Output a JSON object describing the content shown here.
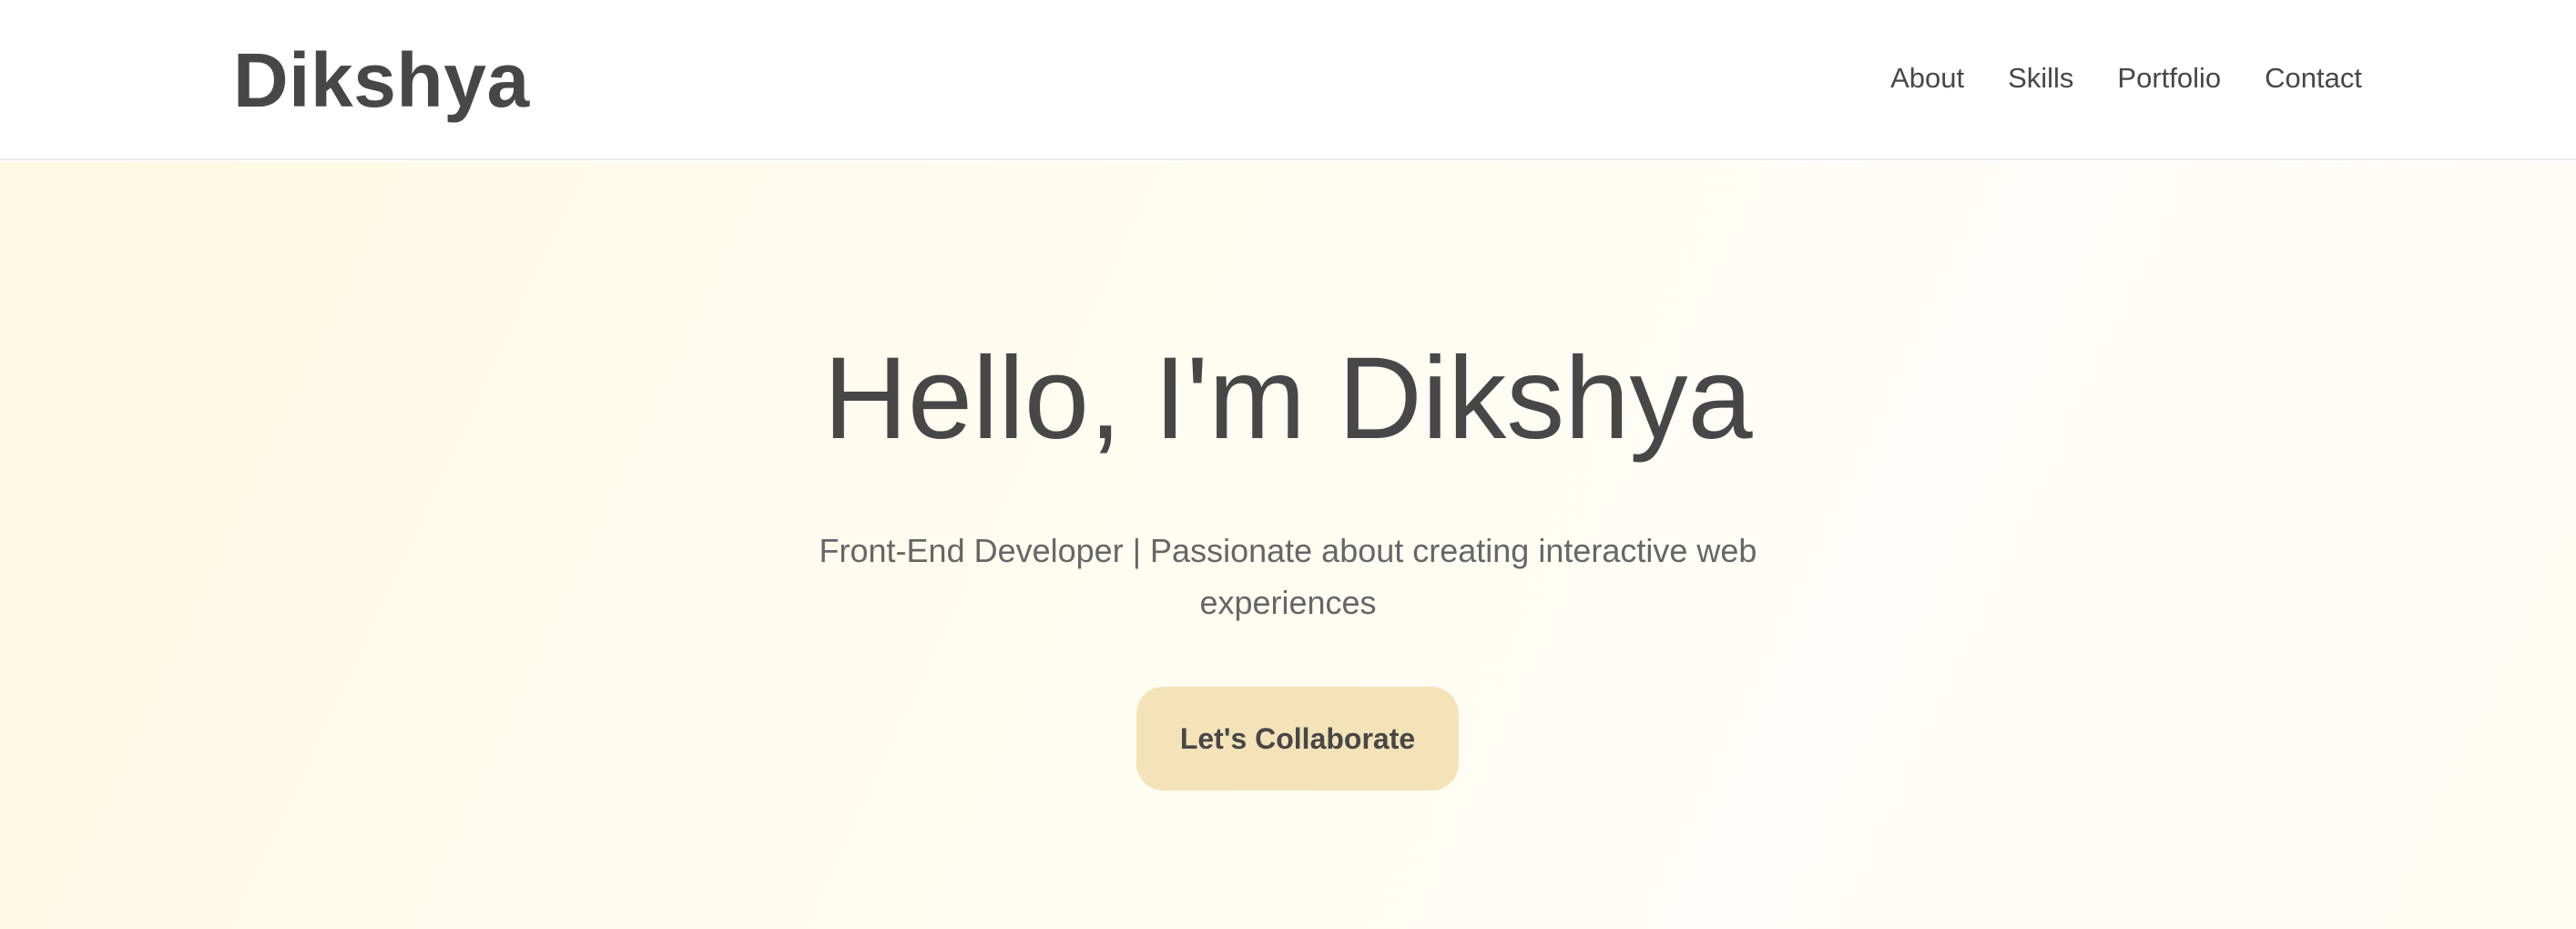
{
  "header": {
    "brand": "Dikshya",
    "nav": [
      {
        "label": "About"
      },
      {
        "label": "Skills"
      },
      {
        "label": "Portfolio"
      },
      {
        "label": "Contact"
      }
    ]
  },
  "hero": {
    "title": "Hello, I'm Dikshya",
    "subtitle": "Front-End Developer | Passionate about creating interactive web experiences",
    "cta_label": "Let's Collaborate"
  },
  "colors": {
    "text": "#474747",
    "subtitle": "#666666",
    "button_bg": "#f4e3b8",
    "hero_bg": "#fffaea"
  }
}
